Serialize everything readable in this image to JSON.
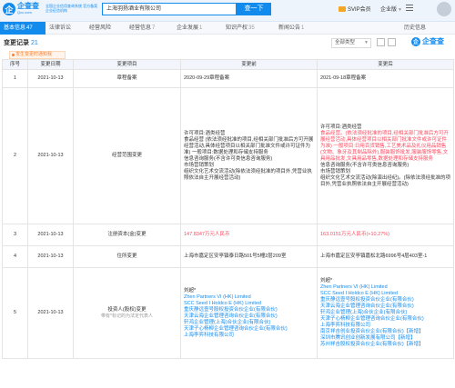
{
  "header": {
    "logo_char": "企",
    "logo_title": "企查查",
    "logo_sub": "Qcc.com",
    "tagline": "全国企业信用查询系统 官方备案企业征信机构",
    "search_value": "上海羽扬酒业有限公司",
    "search_button": "查一下",
    "vip_label": "SVIP会员",
    "enterprise_label": "企业版"
  },
  "tabs": [
    {
      "label": "基本信息",
      "count": "47"
    },
    {
      "label": "法律诉讼",
      "count": ""
    },
    {
      "label": "经营风险",
      "count": ""
    },
    {
      "label": "经营信息",
      "count": "7"
    },
    {
      "label": "企业发展",
      "count": "1"
    },
    {
      "label": "知识产权",
      "count": "35"
    },
    {
      "label": "新闻公告",
      "count": "1"
    },
    {
      "label": "历史信息",
      "count": ""
    }
  ],
  "section": {
    "title": "变更记录",
    "count": "21",
    "hint": "发生变更时通知我",
    "filter_label": "全部类型",
    "brand": "企查查"
  },
  "table": {
    "headers": [
      "序号",
      "变更日期",
      "变更项目",
      "变更前",
      "变更后"
    ],
    "rows": [
      {
        "no": "1",
        "date": "2021-10-13",
        "item": "章程备案",
        "item_sub": "",
        "before": [
          {
            "t": "2020-09-29章程备案",
            "red": false
          }
        ],
        "after": [
          {
            "t": "2021-09-18章程备案",
            "red": false
          }
        ]
      },
      {
        "no": "2",
        "date": "2021-10-13",
        "item": "经营范围变更",
        "item_sub": "",
        "before": [
          {
            "t": "许可项目:酒类经营",
            "red": false
          },
          {
            "t": "食品经营 (依法须经批准的项目,经相关部门批准后方可开展经营活动,具体经营项目以相关部门批准文件或许可证件为准) 一般项目:数据处理和存储支持服务",
            "red": false
          },
          {
            "t": "信息咨询服务(不含许可类信息咨询服务)",
            "red": false
          },
          {
            "t": "市场营销策划",
            "red": false
          },
          {
            "t": "组织文化艺术交流活动(除依法须经批准的项目外,凭营业执照依法自主开展经营活动)",
            "red": false
          }
        ],
        "after": [
          {
            "t": "许可项目:酒类经营",
            "red": false
          },
          {
            "t": "食品经营。(依法须经批准的项目,经相关部门批准后方可开展经营活动,具体经营项目以相关部门批准文件或许可证件为准) 一般项目:日用百货销售,工艺美术品及礼仪用品销售(文物、象牙及其制品除外),服装服饰批发,服装服饰零售,文具用品批发,文具用品零售,数据处理和存储支持服务",
            "red": true
          },
          {
            "t": "信息咨询服务(不含许可类信息咨询服务)",
            "red": false
          },
          {
            "t": "市场营销策划",
            "red": false
          },
          {
            "t": "组织文化艺术交流活动(除演出经纪)。(除依法须经批准的项目外,凭营业执照依法自主开展经营活动)",
            "red": false
          }
        ]
      },
      {
        "no": "3",
        "date": "2021-10-13",
        "item": "注册资本(金)变更",
        "item_sub": "",
        "before": [
          {
            "t": "147.8347万元人民币",
            "red": true
          }
        ],
        "after": [
          {
            "t": "163.0151万元人民币(+10.27%)",
            "red": true
          }
        ]
      },
      {
        "no": "4",
        "date": "2021-10-13",
        "item": "住所变更",
        "item_sub": "",
        "before": [
          {
            "t": "上海市嘉定区安亭镇泰日路501号5幢2层209室",
            "red": false
          }
        ],
        "after": [
          {
            "t": "上海市嘉定区安亭镇嘉松北路6996号4层403室-1",
            "red": false
          }
        ]
      },
      {
        "no": "5",
        "date": "2021-10-13",
        "item": "投资人(股权)变更",
        "item_sub": "带有*标记的为法定代表人",
        "before": [
          {
            "t": "刘超*",
            "red": false
          },
          {
            "t": "Zhen Partners VI (HK) Limited",
            "red": false
          },
          {
            "t": "SCC Seed I Holdco E (HK) Limited",
            "red": false
          },
          {
            "t": "重庆静远壹号股权投资合伙企业(有限合伙)",
            "red": false
          },
          {
            "t": "天津云海企业管理咨询合伙企业(有限合伙)",
            "red": false
          },
          {
            "t": "轩鸿企业管理(上海)合伙企业(有限合伙)",
            "red": false
          },
          {
            "t": "天津子心杨柳企业管理咨询合伙企业(有限合伙)",
            "red": false
          },
          {
            "t": "上海李弈科技有限公司",
            "red": false
          }
        ],
        "after": [
          {
            "t": "刘超*",
            "red": false
          },
          {
            "t": "Zhen Partners VI (HK) Limited",
            "red": false
          },
          {
            "t": "SCC Seed I Holdco E (HK) Limited",
            "red": false
          },
          {
            "t": "重庆静远壹号股权投资合伙企业(有限合伙)",
            "red": false
          },
          {
            "t": "天津云海企业管理咨询合伙企业(有限合伙)",
            "red": false
          },
          {
            "t": "轩鸿企业管理(上海)合伙企业(有限合伙)",
            "red": false
          },
          {
            "t": "天津子心杨柳企业管理咨询合伙企业(有限合伙)",
            "red": false
          },
          {
            "t": "上海李弈科技有限公司",
            "red": false
          },
          {
            "t": "南京祥吉创业投资合伙企业(有限合伙)【新增】",
            "red": false
          },
          {
            "t": "深圳市腾讯创业创新发展有限公司【新增】",
            "red": false
          },
          {
            "t": "苏州祥吉股权投资合伙企业(有限合伙)【新增】",
            "red": false
          }
        ]
      }
    ]
  },
  "colors": {
    "accent": "#128bed",
    "highlight": "#fd485e",
    "warning": "#ff7f2a"
  }
}
